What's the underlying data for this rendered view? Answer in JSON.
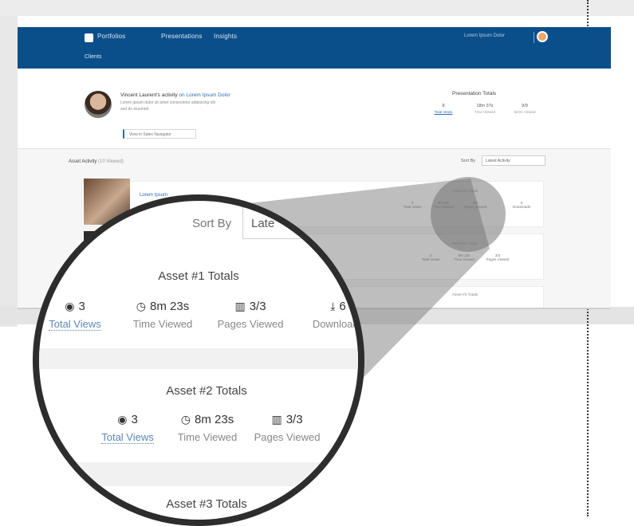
{
  "app": {
    "nav": {
      "links": [
        "Portfolios",
        "Presentations",
        "Insights"
      ],
      "sub_link": "Clients",
      "user": "Lorem Ipsum Dolor"
    },
    "profile": {
      "title_prefix": "Vincent Laurent's activity",
      "title_link": "on Lorem Ipsum Dolor",
      "line1": "Lorem ipsum dolor sit amet consectetur adipiscing elit",
      "line2": "sed do eiusmod",
      "button": "View in Sales Navigator"
    },
    "presentation": {
      "title": "Presentation Totals",
      "stats": [
        {
          "value": "8",
          "label": "Total Views"
        },
        {
          "value": "18m 37s",
          "label": "Time Viewed"
        },
        {
          "value": "9/9",
          "label": "Items Viewed"
        }
      ]
    },
    "activity": {
      "title": "Asset Activity",
      "count": "(10 Viewed)",
      "sort_label": "Sort By",
      "sort_value": "Latest Activity"
    },
    "card1": {
      "link": "Lorem Ipsum",
      "totals_title": "Asset #1 Totals",
      "stats": [
        {
          "value": "3",
          "label": "Total Views"
        },
        {
          "value": "8m 23s",
          "label": "Time Viewed"
        },
        {
          "value": "3/3",
          "label": "Pages Viewed"
        },
        {
          "value": "6",
          "label": "Downloads"
        }
      ]
    },
    "card2": {
      "totals_title": "Asset #2 Totals",
      "stats": [
        {
          "value": "3",
          "label": "Total Views"
        },
        {
          "value": "8m 23s",
          "label": "Time Viewed"
        },
        {
          "value": "3/3",
          "label": "Pages Viewed"
        }
      ]
    },
    "card3": {
      "totals_title": "Asset #3 Totals"
    }
  },
  "magnifier": {
    "sort_label": "Sort By",
    "sort_value": "Late",
    "asset1_title": "Asset #1 Totals",
    "asset1_stats": [
      {
        "value": "3",
        "label": "Total Views",
        "icon": "eye-icon"
      },
      {
        "value": "8m 23s",
        "label": "Time Viewed",
        "icon": "clock-icon"
      },
      {
        "value": "3/3",
        "label": "Pages Viewed",
        "icon": "book-icon"
      },
      {
        "value": "6",
        "label": "Downloads",
        "icon": "download-icon"
      }
    ],
    "asset2_title": "Asset #2 Totals",
    "asset2_stats": [
      {
        "value": "3",
        "label": "Total Views",
        "icon": "eye-icon"
      },
      {
        "value": "8m 23s",
        "label": "Time Viewed",
        "icon": "clock-icon"
      },
      {
        "value": "3/3",
        "label": "Pages Viewed",
        "icon": "book-icon"
      }
    ],
    "asset3_title": "Asset #3 Totals"
  },
  "colors": {
    "nav": "#0b4f8a",
    "link": "#2a6bb0",
    "frame": "#2d2d2d"
  }
}
